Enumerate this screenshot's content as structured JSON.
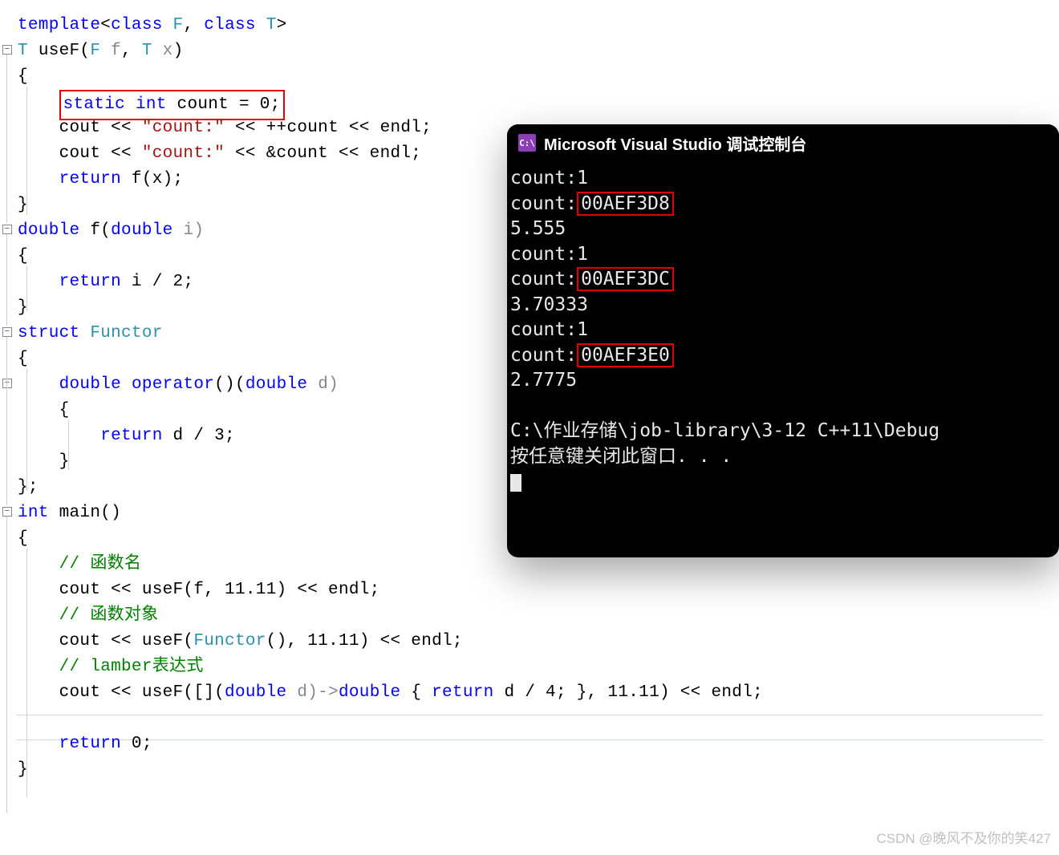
{
  "code": {
    "l1_template": "template",
    "l1_class": "class",
    "l1_F": "F",
    "l1_T": "T",
    "l2_T": "T",
    "l2_useF": "useF",
    "l2_F": "F",
    "l2_f": "f",
    "l2_T2": "T",
    "l2_x": "x",
    "l3_brace": "{",
    "l4_static": "static",
    "l4_int": "int",
    "l4_rest": " count = 0;",
    "l5_cout": "cout << ",
    "l5_str": "\"count:\"",
    "l5_mid": " << ++count << endl;",
    "l6_cout": "cout << ",
    "l6_str": "\"count:\"",
    "l6_mid": " << &count << endl;",
    "l7_return": "return",
    "l7_rest": " f(x);",
    "l8_brace": "}",
    "l9_double": "double",
    "l9_f": " f(",
    "l9_dbl2": "double",
    "l9_i": " i)",
    "l10_brace": "{",
    "l11_return": "return",
    "l11_rest": " i / 2;",
    "l12_brace": "}",
    "l13_struct": "struct",
    "l13_name": " Functor",
    "l14_brace": "{",
    "l15_double": "double",
    "l15_op": " operator()( ",
    "l15_dbl2": "double",
    "l15_d": " d)",
    "l16_brace": "{",
    "l17_return": "return",
    "l17_rest": " d / 3;",
    "l18_brace": "}",
    "l19_close": "};",
    "l20_int": "int",
    "l20_main": " main()",
    "l21_brace": "{",
    "l22_cmt": "// 函数名",
    "l23_pre": "cout << useF(f, 11.11) << endl;",
    "l24_cmt": "// 函数对象",
    "l25_pre": "cout << useF(",
    "l25_fun": "Functor",
    "l25_post": "(), 11.11) << endl;",
    "l26_cmt": "// lamber表达式",
    "l27_a": "cout << useF([](",
    "l27_dbl": "double",
    "l27_b": " d)->",
    "l27_dbl2": "double",
    "l27_c": " { ",
    "l27_ret": "return",
    "l27_d": " d / 4; }, 11.11) << endl;",
    "l29_return": "return",
    "l29_rest": " 0;",
    "l30_brace": "}"
  },
  "console": {
    "title": "Microsoft Visual Studio 调试控制台",
    "lines": {
      "c1": "count:1",
      "c2a": "count:",
      "c2b": "00AEF3D8",
      "c3": "5.555",
      "c4": "count:1",
      "c5a": "count:",
      "c5b": "00AEF3DC",
      "c6": "3.70333",
      "c7": "count:1",
      "c8a": "count:",
      "c8b": "00AEF3E0",
      "c9": "2.7775",
      "c11": "C:\\作业存储\\job-library\\3-12 C++11\\Debug",
      "c12": "按任意键关闭此窗口. . ."
    }
  },
  "watermark": "CSDN @晚风不及你的笑427",
  "icon_label": "C:\\"
}
